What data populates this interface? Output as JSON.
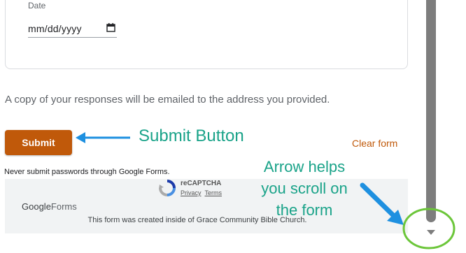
{
  "date_field": {
    "label": "Date",
    "placeholder": "mm/dd/yyyy",
    "icon": "calendar-icon"
  },
  "copy_note": "A copy of your responses will be emailed to the address you provided.",
  "actions": {
    "submit_label": "Submit",
    "clear_label": "Clear form"
  },
  "never_note": "Never submit passwords through Google Forms.",
  "footer": {
    "recaptcha_name": "reCAPTCHA",
    "recaptcha_privacy": "Privacy",
    "recaptcha_terms": "Terms",
    "logo_google": "Google",
    "logo_forms": "Forms",
    "created_note": "This form was created inside of Grace Community Bible Church."
  },
  "annotations": {
    "submit_hint": "Submit Button",
    "arrow_hint_1": "Arrow helps",
    "arrow_hint_2": "you scroll on",
    "arrow_hint_3": "the form"
  },
  "colors": {
    "accent": "#c0590a",
    "annotation_text": "#1aa389",
    "annotation_arrow": "#1e90e0",
    "highlight_circle": "#6cc63a"
  }
}
